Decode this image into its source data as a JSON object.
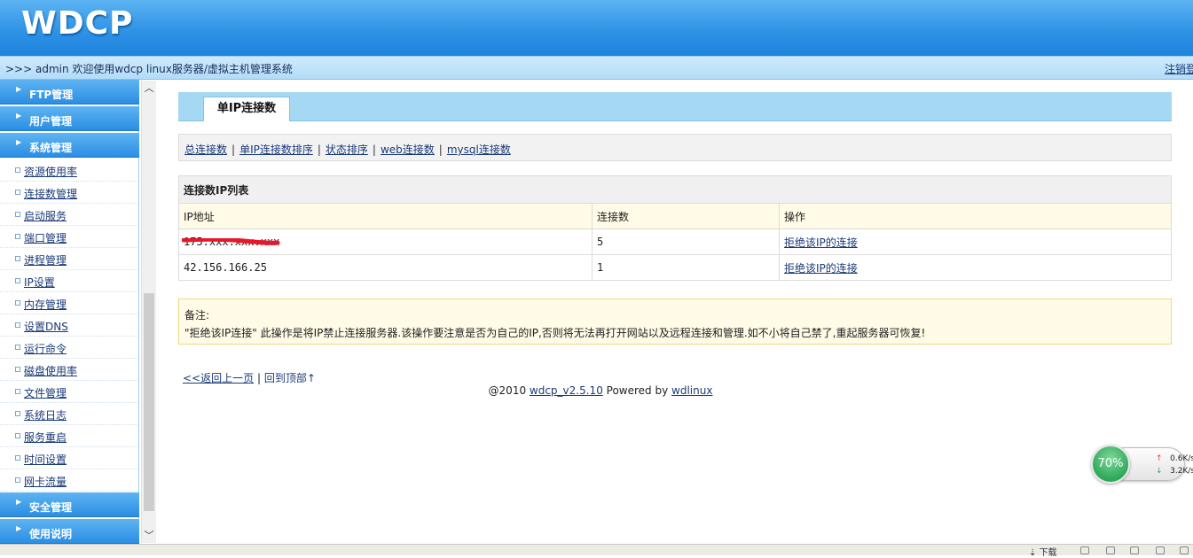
{
  "header": {
    "logo": "WDCP"
  },
  "welcome": {
    "text": ">>> admin 欢迎使用wdcp linux服务器/虚拟主机管理系统",
    "logout": "注销登"
  },
  "sidebar": {
    "categories_top": [
      {
        "label": "FTP管理"
      },
      {
        "label": "用户管理"
      },
      {
        "label": "系统管理"
      }
    ],
    "items": [
      {
        "label": "资源使用率"
      },
      {
        "label": "连接数管理"
      },
      {
        "label": "启动服务"
      },
      {
        "label": "端口管理"
      },
      {
        "label": "进程管理"
      },
      {
        "label": "IP设置"
      },
      {
        "label": "内存管理"
      },
      {
        "label": "设置DNS"
      },
      {
        "label": "运行命令"
      },
      {
        "label": "磁盘使用率"
      },
      {
        "label": "文件管理"
      },
      {
        "label": "系统日志"
      },
      {
        "label": "服务重启"
      },
      {
        "label": "时间设置"
      },
      {
        "label": "网卡流量"
      }
    ],
    "categories_bottom": [
      {
        "label": "安全管理"
      },
      {
        "label": "使用说明"
      }
    ]
  },
  "main": {
    "tab": "单IP连接数",
    "subnav": [
      "总连接数",
      "单IP连接数排序",
      "状态排序",
      "web连接数",
      "mysql连接数"
    ],
    "table": {
      "caption": "连接数IP列表",
      "headers": [
        "IP地址",
        "连接数",
        "操作"
      ],
      "rows": [
        {
          "ip": "175.xxx.xxx.xxx",
          "count": "5",
          "action": "拒绝该IP的连接"
        },
        {
          "ip": "42.156.166.25",
          "count": "1",
          "action": "拒绝该IP的连接"
        }
      ]
    },
    "note": {
      "title": "备注:",
      "text": "\"拒绝该IP连接\" 此操作是将IP禁止连接服务器.该操作要注意是否为自己的IP,否则将无法再打开网站以及远程连接和管理.如不小将自己禁了,重起服务器可恢复!"
    },
    "back_links": {
      "back": "<<返回上一页",
      "separator": "|",
      "top": "回到顶部↑"
    },
    "footer": {
      "prefix": "@2010 ",
      "version_link": "wdcp_v2.5.10",
      "powered": " Powered by ",
      "brand_link": "wdlinux"
    }
  },
  "net_widget": {
    "percent": "70%",
    "upload": "0.6K/s",
    "download": "3.2K/s"
  },
  "statusbar": {
    "download": "下载"
  },
  "colors": {
    "header_blue": "#2f93e6",
    "tab_bar": "#a5d8f3",
    "note_bg": "#fffbe6",
    "redact": "#e8182a",
    "widget_green": "#2ea85a"
  }
}
